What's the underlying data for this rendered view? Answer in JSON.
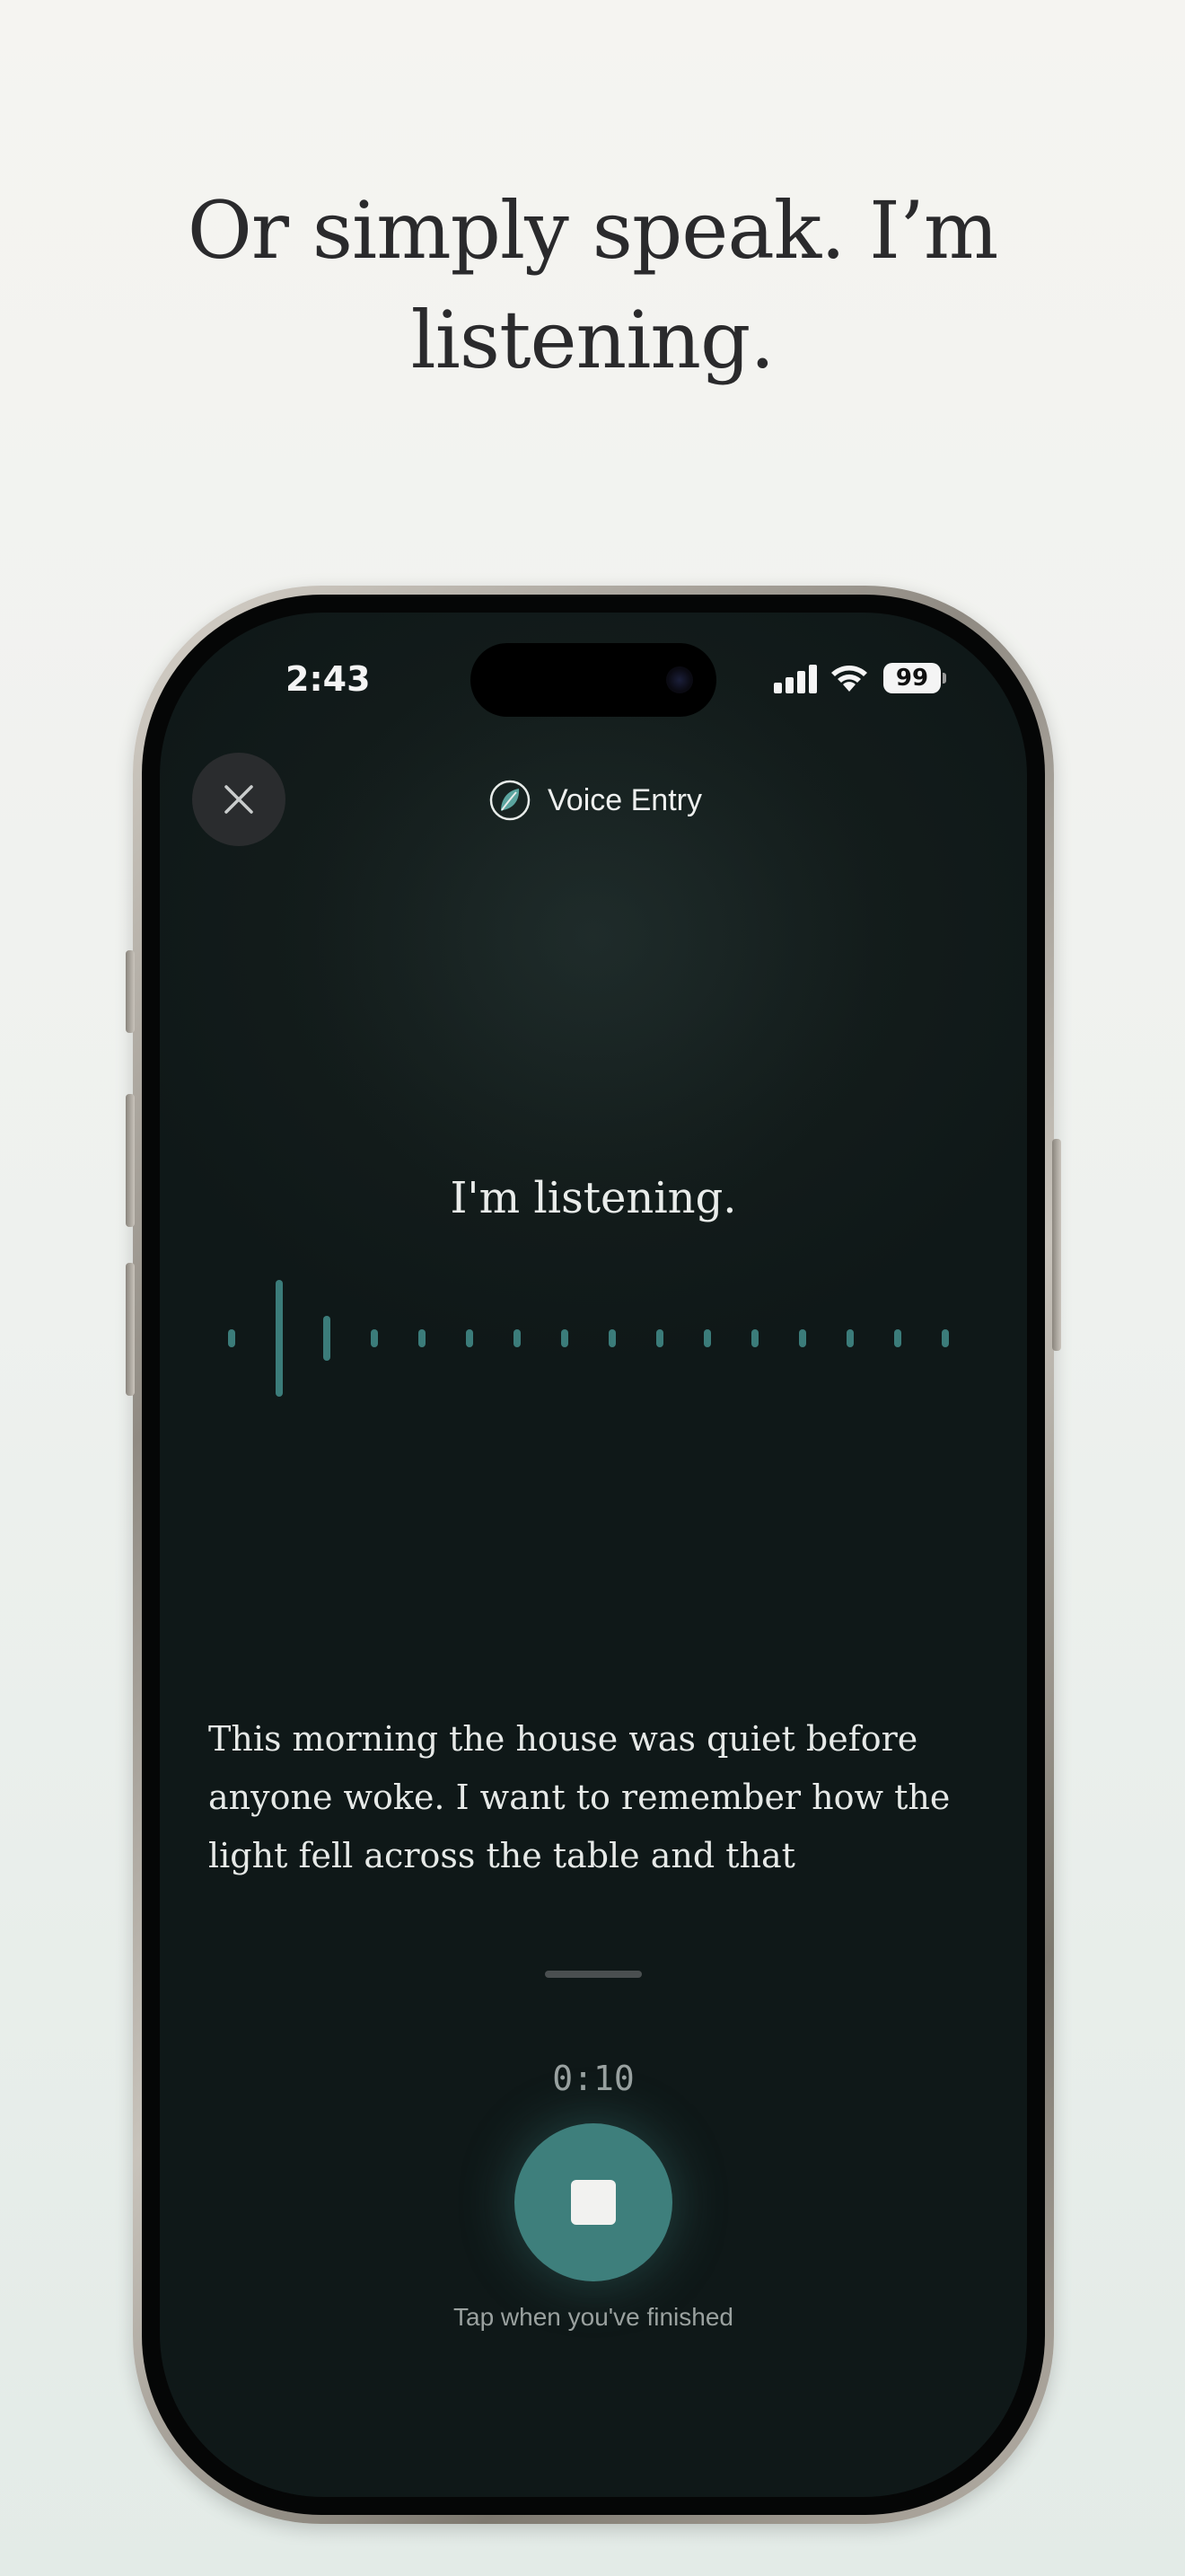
{
  "headline": {
    "line1": "Or simply speak. I’m",
    "line2": "listening."
  },
  "status_bar": {
    "time": "2:43",
    "battery": "99",
    "icons": [
      "signal-icon",
      "wifi-icon",
      "battery-icon"
    ]
  },
  "header": {
    "close_icon": "close-icon",
    "logo_icon": "leaf-icon",
    "title": "Voice Entry"
  },
  "main": {
    "status_text": "I'm listening.",
    "waveform_levels": [
      0.08,
      0.52,
      0.2,
      0.08,
      0.08,
      0.08,
      0.08,
      0.08,
      0.08,
      0.08,
      0.08,
      0.08,
      0.08,
      0.08,
      0.08,
      0.08
    ],
    "transcript_lines": [
      "This morning the house was quiet before",
      "anyone woke. I want to remember how the",
      "light fell across the table and that"
    ]
  },
  "controls": {
    "timer": "0:10",
    "stop_icon": "stop-icon",
    "hint": "Tap when you've finished"
  },
  "colors": {
    "accent": "#3e7f7c",
    "waveform": "#3b7c7a",
    "screen_bg": "#111a1a",
    "page_bg": "#f1f2ef"
  }
}
